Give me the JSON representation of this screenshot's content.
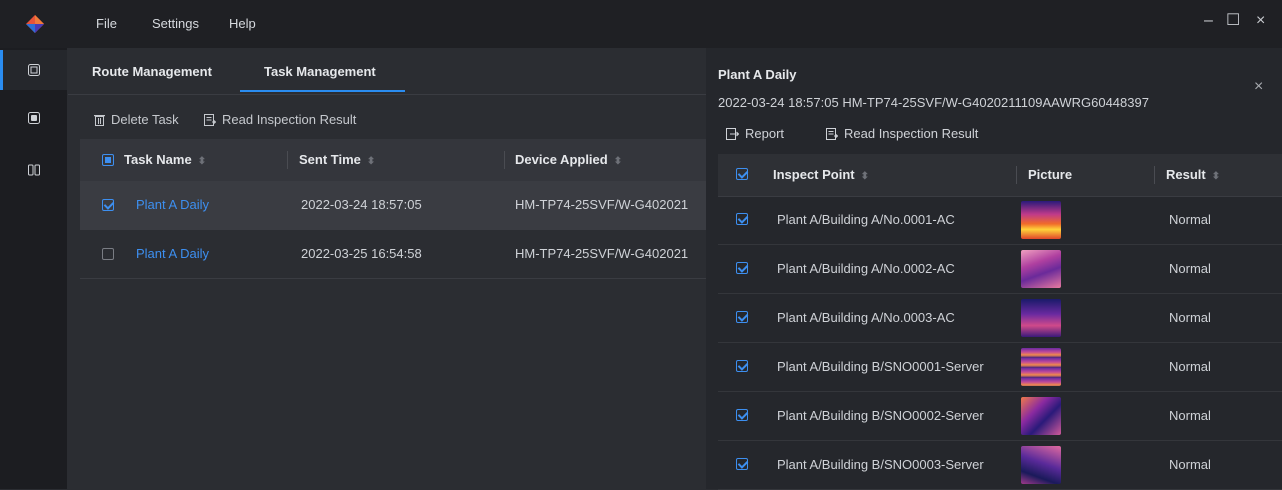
{
  "menu": {
    "file": "File",
    "settings": "Settings",
    "help": "Help"
  },
  "window_controls": {
    "minimize": "–",
    "maximize": "☐",
    "close": "×"
  },
  "tabs": {
    "route": "Route Management",
    "task": "Task Management"
  },
  "toolbar": {
    "delete": "Delete Task",
    "read": "Read Inspection Result"
  },
  "table": {
    "headers": {
      "name": "Task Name",
      "sent": "Sent Time",
      "device": "Device Applied"
    },
    "rows": [
      {
        "name": "Plant A Daily",
        "sent": "2022-03-24 18:57:05",
        "device": "HM-TP74-25SVF/W-G402021",
        "checked": true
      },
      {
        "name": "Plant A Daily",
        "sent": "2022-03-25 16:54:58",
        "device": "HM-TP74-25SVF/W-G402021",
        "checked": false
      }
    ]
  },
  "panel": {
    "title": "Plant A Daily",
    "subtitle": "2022-03-24 18:57:05  HM-TP74-25SVF/W-G4020211109AAWRG60448397",
    "close": "×",
    "report": "Report",
    "read": "Read Inspection Result",
    "headers": {
      "point": "Inspect Point",
      "picture": "Picture",
      "result": "Result"
    },
    "rows": [
      {
        "point": "Plant A/Building A/No.0001-AC",
        "result": "Normal"
      },
      {
        "point": "Plant A/Building A/No.0002-AC",
        "result": "Normal"
      },
      {
        "point": "Plant A/Building A/No.0003-AC",
        "result": "Normal"
      },
      {
        "point": "Plant A/Building B/SNO0001-Server",
        "result": "Normal"
      },
      {
        "point": "Plant A/Building B/SNO0002-Server",
        "result": "Normal"
      },
      {
        "point": "Plant A/Building B/SNO0003-Server",
        "result": "Normal"
      }
    ]
  },
  "colors": {
    "accent": "#2a8cf0",
    "link": "#3d8ff0",
    "background": "#2b2d32"
  }
}
